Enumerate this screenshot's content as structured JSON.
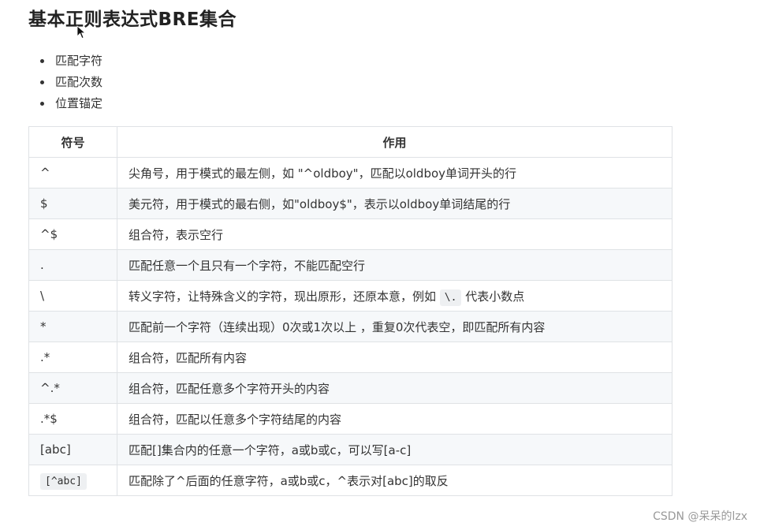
{
  "title": "基本正则表达式BRE集合",
  "bullets": [
    "匹配字符",
    "匹配次数",
    "位置锚定"
  ],
  "table": {
    "headers": [
      "符号",
      "作用"
    ],
    "rows": [
      {
        "symbol": "^",
        "desc": "尖角号，用于模式的最左侧，如 \"^oldboy\"，匹配以oldboy单词开头的行"
      },
      {
        "symbol": "$",
        "desc": "美元符，用于模式的最右侧，如\"oldboy$\"，表示以oldboy单词结尾的行"
      },
      {
        "symbol": "^$",
        "desc": "组合符，表示空行"
      },
      {
        "symbol": ".",
        "desc": "匹配任意一个且只有一个字符，不能匹配空行"
      },
      {
        "symbol": "\\",
        "desc_before": "转义字符，让特殊含义的字符，现出原形，还原本意，例如 ",
        "desc_code": "\\.",
        "desc_after": " 代表小数点"
      },
      {
        "symbol": "*",
        "desc": "匹配前一个字符（连续出现）0次或1次以上 ，重复0次代表空，即匹配所有内容"
      },
      {
        "symbol": ".*",
        "desc": "组合符，匹配所有内容"
      },
      {
        "symbol": "^.*",
        "desc": "组合符，匹配任意多个字符开头的内容"
      },
      {
        "symbol": ".*$",
        "desc": "组合符，匹配以任意多个字符结尾的内容"
      },
      {
        "symbol": "[abc]",
        "desc": "匹配[]集合内的任意一个字符，a或b或c，可以写[a-c]"
      },
      {
        "symbol_code": "[^abc]",
        "desc": "匹配除了^后面的任意字符，a或b或c，^表示对[abc]的取反"
      }
    ]
  },
  "watermark": "CSDN @呆呆的lzx",
  "icons": {
    "cursor": "mouse-pointer-icon"
  }
}
